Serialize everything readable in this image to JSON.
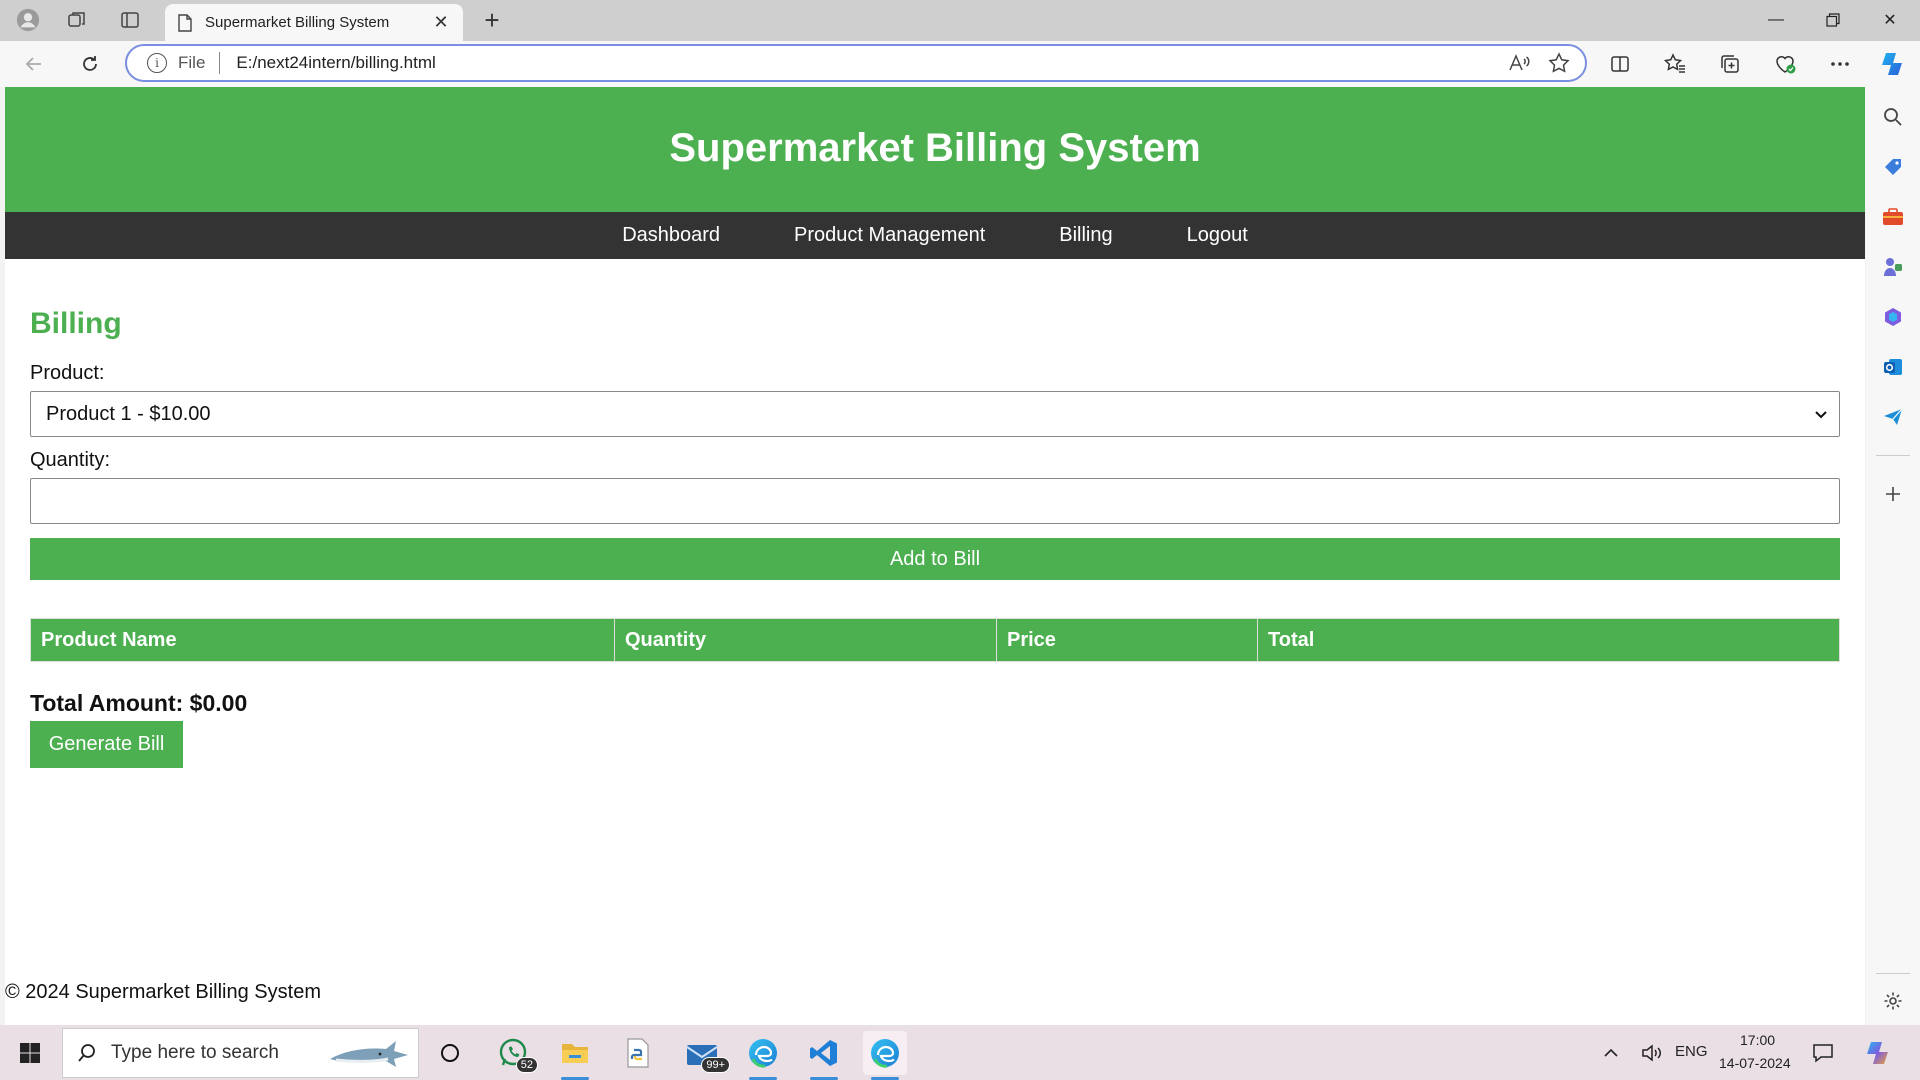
{
  "browser": {
    "tab_title": "Supermarket Billing System",
    "address_scheme_label": "File",
    "url": "E:/next24intern/billing.html"
  },
  "site": {
    "title": "Supermarket Billing System",
    "nav": [
      "Dashboard",
      "Product Management",
      "Billing",
      "Logout"
    ],
    "accent_color": "#4caf50",
    "nav_bg_color": "#333333"
  },
  "billing": {
    "heading": "Billing",
    "product_label": "Product:",
    "product_selected": "Product 1 - $10.00",
    "quantity_label": "Quantity:",
    "quantity_value": "",
    "add_button": "Add to Bill",
    "table_headers": [
      "Product Name",
      "Quantity",
      "Price",
      "Total"
    ],
    "table_rows": [],
    "total_amount": "Total Amount: $0.00",
    "generate_button": "Generate Bill"
  },
  "footer": {
    "text": "© 2024 Supermarket Billing System"
  },
  "taskbar": {
    "search_placeholder": "Type here to search",
    "whatsapp_badge": "52",
    "mail_badge": "99+",
    "language": "ENG",
    "time": "17:00",
    "date": "14-07-2024"
  }
}
